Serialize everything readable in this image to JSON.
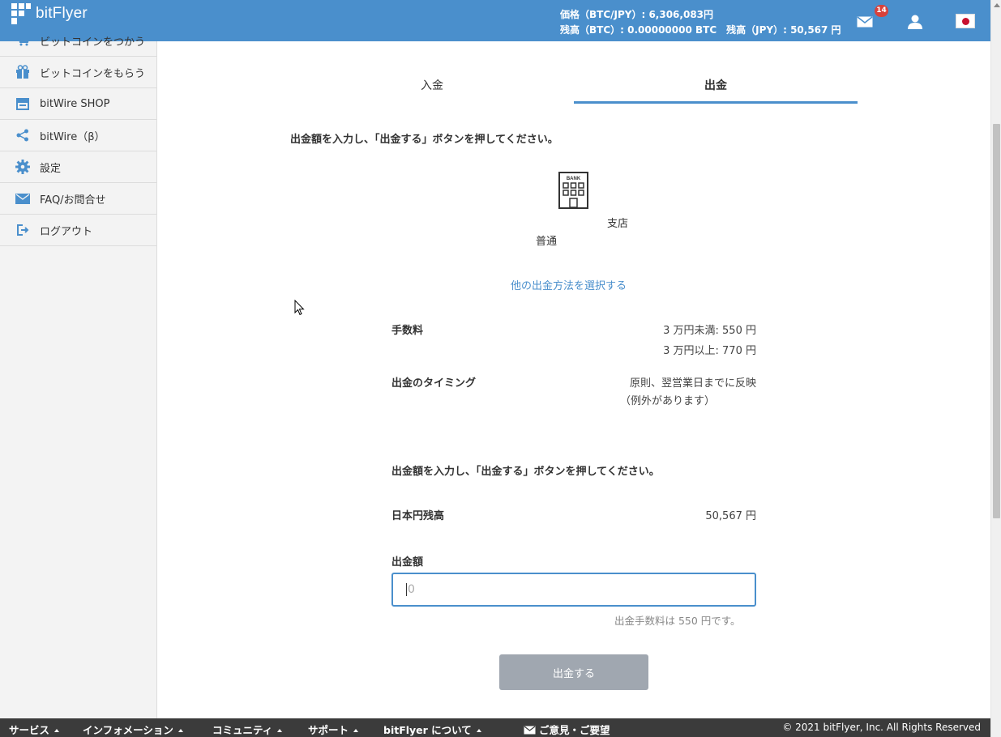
{
  "header": {
    "logo_text": "bitFlyer",
    "price_line": "価格（BTC/JPY）: 6,306,083円",
    "balance_line": "残高（BTC）: 0.00000000 BTC　残高（JPY）: 50,567 円",
    "mail_badge": "14",
    "icons": [
      "mail-icon",
      "user-icon",
      "japan-flag-icon"
    ]
  },
  "sidebar": {
    "items": [
      {
        "label": "ビットコインをつかう",
        "icon": "cart-icon"
      },
      {
        "label": "ビットコインをもらう",
        "icon": "gift-icon"
      },
      {
        "label": "bitWire SHOP",
        "icon": "shop-icon"
      },
      {
        "label": "bitWire（β）",
        "icon": "share-icon"
      },
      {
        "label": "設定",
        "icon": "gear-icon"
      },
      {
        "label": "FAQ/お問合せ",
        "icon": "mail-icon"
      },
      {
        "label": "ログアウト",
        "icon": "logout-icon"
      }
    ]
  },
  "tabs": {
    "deposit": "入金",
    "withdraw": "出金",
    "active": "withdraw"
  },
  "instruction": "出金額を入力し、「出金する」ボタンを押してください。",
  "bank": {
    "icon_label": "BANK",
    "branch": "支店",
    "account_type": "普通"
  },
  "other_method_link": "他の出金方法を選択する",
  "fees": {
    "label": "手数料",
    "under": "3 万円未満: 550 円",
    "over": "3 万円以上: 770 円"
  },
  "timing": {
    "label": "出金のタイミング",
    "line1": "原則、翌営業日までに反映",
    "line2": "（例外があります）"
  },
  "form": {
    "instruction": "出金額を入力し、「出金する」ボタンを押してください。",
    "balance_label": "日本円残高",
    "balance_value": "50,567 円",
    "amount_label": "出金額",
    "amount_placeholder": "0",
    "fee_note": "出金手数料は 550 円です。",
    "submit_label": "出金する"
  },
  "footer": {
    "items": [
      "サービス",
      "インフォメーション",
      "コミュニティ",
      "サポート",
      "bitFlyer について"
    ],
    "feedback": "ご意見・ご要望",
    "copyright": "© 2021 bitFlyer, Inc. All Rights Reserved"
  },
  "colors": {
    "brand": "#4a8fcc",
    "footer": "#3b3b3b",
    "badge": "#d9413a",
    "button_disabled": "#a0a7b0"
  }
}
